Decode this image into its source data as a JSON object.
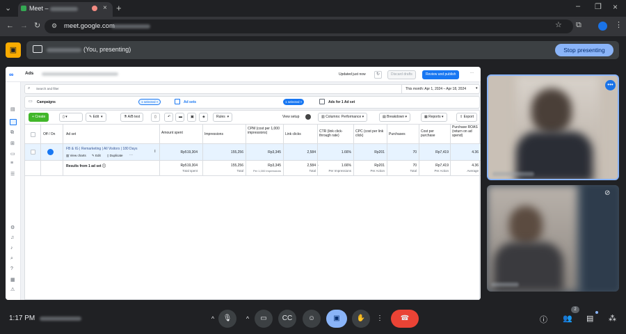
{
  "browser": {
    "tab_title": "Meet –",
    "url": "meet.google.com"
  },
  "meet": {
    "presenting_label": "(You, presenting)",
    "stop_presenting": "Stop presenting",
    "time": "1:17 PM",
    "participants_count": "2"
  },
  "ads": {
    "app_title": "Ads",
    "status": "Updated just now",
    "discard": "Discard drafts",
    "review_publish": "Review and publish",
    "search_placeholder": "Search and filter",
    "date_range": "This month: Apr 1, 2024 – Apr 18, 2024",
    "campaigns_label": "Campaigns",
    "campaigns_selected": "1 selected",
    "adsets_label": "Ad sets",
    "adsets_selected": "1 selected",
    "ads_label": "Ads for 1 Ad set",
    "toolbar": {
      "create": "Create",
      "edit": "Edit",
      "ab_test": "A/B test",
      "rules": "Rules",
      "view_setup": "View setup",
      "columns": "Columns: Performance",
      "breakdown": "Breakdown",
      "reports": "Reports",
      "export": "Export"
    },
    "table": {
      "headers": {
        "off_on": "Off / On",
        "ad_set": "Ad set",
        "amount_spent": "Amount spent",
        "impressions": "Impressions",
        "cpm": "CPM (cost per 1,000 impressions)",
        "link_clicks": "Link clicks",
        "ctr": "CTR (link click-through rate)",
        "cpc": "CPC (cost per link click)",
        "purchases": "Purchases",
        "cost_per_purchase": "Cost per purchase",
        "roas": "Purchase ROAS (return on ad spend)"
      },
      "row": {
        "name": "FB & IG | Remarketing | All Visitors | 180 Days",
        "view_charts": "View charts",
        "edit": "Edit",
        "duplicate": "Duplicate",
        "amount_spent": "Rp519,304",
        "impressions": "155,256",
        "cpm": "Rp3,345",
        "link_clicks": "2,584",
        "ctr": "1.66%",
        "cpc": "Rp201",
        "purchases": "70",
        "cost_per_purchase": "Rp7,419",
        "roas": "4.36"
      },
      "summary": {
        "label": "Results from 1 ad set",
        "amount_spent": "Rp519,304",
        "amount_spent_sub": "Total spent",
        "impressions": "155,256",
        "impressions_sub": "Total",
        "cpm": "Rp3,345",
        "cpm_sub": "Per 1,000 Impressions",
        "link_clicks": "2,584",
        "link_clicks_sub": "Total",
        "ctr": "1.66%",
        "ctr_sub": "Per Impressions",
        "cpc": "Rp201",
        "cpc_sub": "Per Action",
        "purchases": "70",
        "purchases_sub": "Total",
        "cost_per_purchase": "Rp7,419",
        "cost_per_purchase_sub": "Per Action",
        "roas": "4.36",
        "roas_sub": "Average"
      }
    }
  },
  "colors": {
    "meet_bg": "#202124",
    "accent_blue": "#1877f2",
    "create_green": "#42b72a",
    "end_call_red": "#ea4335",
    "present_blue": "#8ab4f8"
  }
}
